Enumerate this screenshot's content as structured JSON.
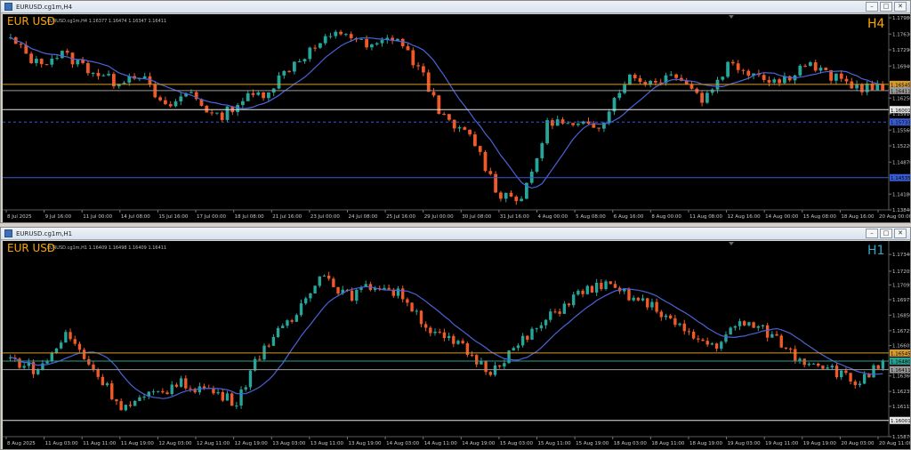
{
  "windows": [
    {
      "title": "EURUSD.cg1m,H4",
      "controls": [
        "–",
        "□",
        "✕"
      ],
      "symbol_label": "EUR USD",
      "timeframe_label": "H4",
      "symbol_color": "#ffa500",
      "timeframe_color": "#ffa500",
      "ohlc_header": "EURUSD.cg1m,H4  1.16377 1.16474 1.16347 1.16411",
      "chart_data": {
        "type": "candlestick",
        "y_range": [
          1.1384,
          1.1798
        ],
        "y_ticks": [
          {
            "v": 1.1798,
            "label": "1.17980"
          },
          {
            "v": 1.1763,
            "label": "1.17630"
          },
          {
            "v": 1.1729,
            "label": "1.17290"
          },
          {
            "v": 1.1694,
            "label": "1.16940"
          },
          {
            "v": 1.1625,
            "label": "1.16250"
          },
          {
            "v": 1.1591,
            "label": "1.15910"
          },
          {
            "v": 1.1556,
            "label": "1.15560"
          },
          {
            "v": 1.1522,
            "label": "1.15220"
          },
          {
            "v": 1.1487,
            "label": "1.14870"
          },
          {
            "v": 1.1418,
            "label": "1.14180"
          },
          {
            "v": 1.1384,
            "label": "1.13840"
          }
        ],
        "x_labels": [
          "8 Jul 2025",
          "9 Jul 16:00",
          "11 Jul 00:00",
          "14 Jul 08:00",
          "15 Jul 16:00",
          "17 Jul 00:00",
          "18 Jul 08:00",
          "21 Jul 16:00",
          "23 Jul 00:00",
          "24 Jul 08:00",
          "25 Jul 16:00",
          "29 Jul 00:00",
          "30 Jul 08:00",
          "31 Jul 16:00",
          "4 Aug 00:00",
          "5 Aug 08:00",
          "6 Aug 16:00",
          "8 Aug 00:00",
          "11 Aug 08:00",
          "12 Aug 16:00",
          "14 Aug 00:00",
          "15 Aug 08:00",
          "18 Aug 16:00",
          "20 Aug 00:00"
        ],
        "anchors": [
          1.175,
          1.17,
          1.172,
          1.169,
          1.166,
          1.168,
          1.16,
          1.164,
          1.158,
          1.162,
          1.164,
          1.17,
          1.174,
          1.177,
          1.173,
          1.176,
          1.168,
          1.157,
          1.154,
          1.142,
          1.141,
          1.158,
          1.156,
          1.157,
          1.167,
          1.166,
          1.168,
          1.162,
          1.17,
          1.168,
          1.166,
          1.17,
          1.167,
          1.165,
          1.1645
        ],
        "candle_count": 170,
        "ma_period": 10,
        "hlines": [
          {
            "v": 1.16545,
            "label": "1.16545",
            "color": "#d69a2d"
          },
          {
            "v": 1.16411,
            "label": "1.16411",
            "color": "#9a9a9a"
          },
          {
            "v": 1.16001,
            "label": "1.16001",
            "color": "#e6e6e6"
          },
          {
            "v": 1.15733,
            "label": "1.15733",
            "color": "#3a5ad0",
            "dashed": true
          },
          {
            "v": 1.14535,
            "label": "1.14535",
            "color": "#3a5ad0"
          }
        ]
      }
    },
    {
      "title": "EURUSD.cg1m,H1",
      "controls": [
        "–",
        "□",
        "✕"
      ],
      "symbol_label": "EUR USD",
      "timeframe_label": "H1",
      "symbol_color": "#ffa500",
      "timeframe_color": "#3aa7c8",
      "ohlc_header": "EURUSD.cg1m,H1  1.16409 1.16498 1.16409 1.16411",
      "chart_data": {
        "type": "candlestick",
        "y_range": [
          1.1587,
          1.1742
        ],
        "y_ticks": [
          {
            "v": 1.1734,
            "label": "1.17340"
          },
          {
            "v": 1.17205,
            "label": "1.17205"
          },
          {
            "v": 1.17095,
            "label": "1.17095"
          },
          {
            "v": 1.16975,
            "label": "1.16975"
          },
          {
            "v": 1.1685,
            "label": "1.16850"
          },
          {
            "v": 1.16725,
            "label": "1.16725"
          },
          {
            "v": 1.16605,
            "label": "1.16605"
          },
          {
            "v": 1.1636,
            "label": "1.16360"
          },
          {
            "v": 1.16235,
            "label": "1.16235"
          },
          {
            "v": 1.16115,
            "label": "1.16115"
          },
          {
            "v": 1.1587,
            "label": "1.15870"
          }
        ],
        "x_labels": [
          "8 Aug 2025",
          "11 Aug 03:00",
          "11 Aug 11:00",
          "11 Aug 19:00",
          "12 Aug 03:00",
          "12 Aug 11:00",
          "12 Aug 19:00",
          "13 Aug 03:00",
          "13 Aug 11:00",
          "13 Aug 19:00",
          "14 Aug 03:00",
          "14 Aug 11:00",
          "14 Aug 19:00",
          "15 Aug 03:00",
          "15 Aug 11:00",
          "15 Aug 19:00",
          "18 Aug 03:00",
          "18 Aug 11:00",
          "18 Aug 19:00",
          "19 Aug 03:00",
          "19 Aug 11:00",
          "19 Aug 19:00",
          "20 Aug 03:00",
          "20 Aug 11:00"
        ],
        "anchors": [
          1.165,
          1.164,
          1.167,
          1.164,
          1.161,
          1.162,
          1.163,
          1.1625,
          1.1615,
          1.166,
          1.168,
          1.172,
          1.17,
          1.171,
          1.17,
          1.167,
          1.166,
          1.164,
          1.166,
          1.168,
          1.17,
          1.171,
          1.17,
          1.169,
          1.167,
          1.166,
          1.168,
          1.167,
          1.165,
          1.1645,
          1.163,
          1.1645
        ],
        "candle_count": 190,
        "ma_period": 12,
        "hlines": [
          {
            "v": 1.16545,
            "label": "1.16545",
            "color": "#d69a2d"
          },
          {
            "v": 1.1648,
            "label": "1.16480",
            "color": "#2aa090"
          },
          {
            "v": 1.16411,
            "label": "1.16411",
            "color": "#9a9a9a"
          },
          {
            "v": 1.16001,
            "label": "1.16001",
            "color": "#e6e6e6"
          }
        ]
      }
    }
  ],
  "colors": {
    "bull": "#26a69a",
    "bear": "#f05a28",
    "ma": "#4a63d8",
    "axis_text": "#c8c8c8",
    "background": "#000000"
  }
}
